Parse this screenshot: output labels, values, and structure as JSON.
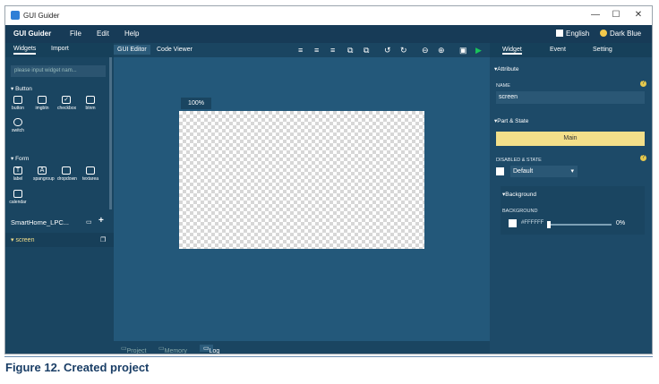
{
  "window": {
    "title": "GUI Guider",
    "controls": [
      "—",
      "☐",
      "✕"
    ]
  },
  "menu": {
    "brand": "GUI Guider",
    "items": [
      "File",
      "Edit",
      "Help"
    ],
    "language": "English",
    "theme": "Dark Blue"
  },
  "left": {
    "tabs": [
      "Widgets",
      "Import"
    ],
    "search_placeholder": "please input widget nam...",
    "button_section": "▾ Button",
    "button_widgets": [
      {
        "label": "button",
        "icon": "button-icon"
      },
      {
        "label": "imgbtn",
        "icon": "imgbtn-icon"
      },
      {
        "label": "checkbox",
        "icon": "checkbox-icon"
      },
      {
        "label": "btnm",
        "icon": "btnm-icon"
      },
      {
        "label": "switch",
        "icon": "switch-icon"
      }
    ],
    "form_section": "▾ Form",
    "form_widgets": [
      {
        "label": "label",
        "icon": "label-icon"
      },
      {
        "label": "spangroup",
        "icon": "spangroup-icon"
      },
      {
        "label": "dropdown",
        "icon": "dropdown-icon"
      },
      {
        "label": "textarea",
        "icon": "textarea-icon"
      },
      {
        "label": "calendar",
        "icon": "calendar-icon"
      }
    ],
    "project_name": "SmartHome_LPC...",
    "screen_item": "▾ screen"
  },
  "center": {
    "tabs": [
      "GUI Editor",
      "Code Viewer"
    ],
    "zoom": "100%",
    "bottom_tabs": [
      "Project",
      "Memory",
      "Log"
    ]
  },
  "right": {
    "tabs": [
      "Widget",
      "Event",
      "Setting"
    ],
    "attribute": "▾Attribute",
    "name_label": "NAME",
    "name_value": "screen",
    "part_state": "▾Part & State",
    "main_button": "Main",
    "disabled_label": "DISABLED & STATE",
    "state_value": "Default",
    "background_section": "▾Background",
    "background_label": "BACKGROUND",
    "color_value": "#FFFFFF",
    "opacity_value": "0%"
  },
  "caption": "Figure 12.  Created project",
  "colors": {
    "panel": "#1a4561",
    "canvas_bg": "#23587a",
    "accent": "#f3df8a",
    "play": "#19c35a"
  }
}
